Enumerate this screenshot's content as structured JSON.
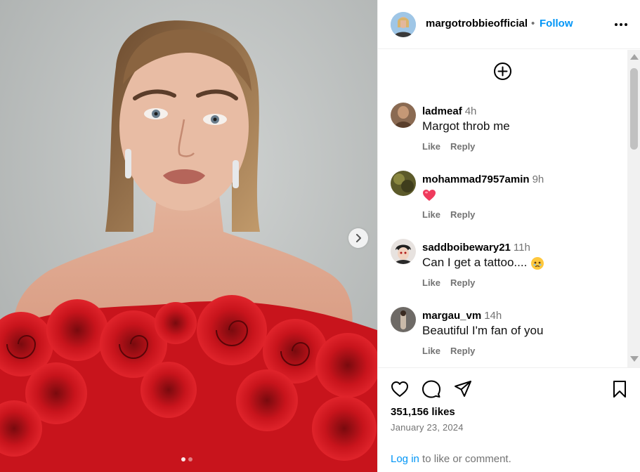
{
  "post": {
    "author": "margotrobbieofficial",
    "separator": "•",
    "follow_label": "Follow",
    "carousel_count": 2,
    "carousel_active": 1
  },
  "comments": [
    {
      "user": "ladmeaf",
      "time": "4h",
      "text": "Margot throb me",
      "emoji": "",
      "like": "Like",
      "reply": "Reply"
    },
    {
      "user": "mohammad7957amin",
      "time": "9h",
      "text": "",
      "emoji": "red-heart-emoji",
      "like": "Like",
      "reply": "Reply"
    },
    {
      "user": "saddboibewary21",
      "time": "11h",
      "text": "Can I get a tattoo....",
      "emoji": "face-holding-back-tears-emoji",
      "like": "Like",
      "reply": "Reply"
    },
    {
      "user": "margau_vm",
      "time": "14h",
      "text": "Beautiful I'm fan of you",
      "emoji": "",
      "like": "Like",
      "reply": "Reply"
    }
  ],
  "stats": {
    "likes": "351,156 likes",
    "date": "January 23, 2024"
  },
  "footer": {
    "login_link": "Log in",
    "login_rest": " to like or comment."
  },
  "icons": {
    "more": "more-options-icon",
    "add": "add-comment-circle-icon",
    "next": "chevron-right-icon",
    "like": "heart-outline-icon",
    "comment": "comment-bubble-icon",
    "share": "paper-plane-icon",
    "save": "bookmark-icon"
  },
  "colors": {
    "link_blue": "#0095f6",
    "secondary_text": "#737373",
    "dress_red": "#c8141c",
    "background_wall": "#b9bcbb"
  }
}
